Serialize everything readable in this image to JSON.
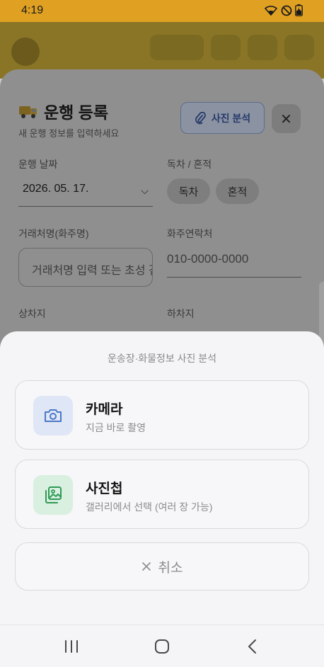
{
  "status_bar": {
    "time": "4:19",
    "icons": [
      "wifi-icon",
      "do-not-disturb-icon",
      "battery-charging-icon"
    ]
  },
  "form": {
    "title": "운행 등록",
    "subtitle": "새 운행 정보를 입력하세요",
    "photo_analysis_label": "사진 분석",
    "close_label": "✕",
    "date_label": "운행 날짜",
    "date_value": "2026. 05. 17.",
    "mode_label": "독차 / 혼적",
    "mode_options": [
      "독차",
      "혼적"
    ],
    "client_label": "거래처명(화주명)",
    "client_placeholder": "거래처명 입력 또는 초성 검색",
    "phone_label": "화주연락처",
    "phone_placeholder": "010-0000-0000",
    "load_label": "상차지",
    "unload_label": "하차지"
  },
  "sheet": {
    "title": "운송장·화물정보 사진 분석",
    "options": [
      {
        "title": "카메라",
        "desc": "지금 바로 촬영",
        "icon": "camera-icon",
        "accent": "#4a78c8"
      },
      {
        "title": "사진첩",
        "desc": "갤러리에서 선택 (여러 장 가능)",
        "icon": "gallery-icon",
        "accent": "#2f9a55"
      }
    ],
    "cancel_label": "취소"
  },
  "colors": {
    "status_bar": "#e0a123",
    "sheet_bg": "#f5f5f7",
    "camera_tile": "#dfe6f5",
    "gallery_tile": "#d9efe0"
  }
}
